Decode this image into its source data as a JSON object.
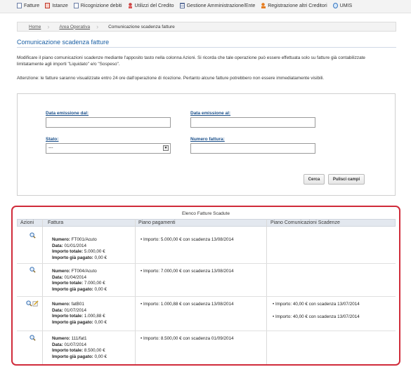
{
  "nav": [
    {
      "label": "Fatture",
      "icon": "document-icon"
    },
    {
      "label": "Istanze",
      "icon": "document-red-icon"
    },
    {
      "label": "Ricognizione debiti",
      "icon": "document-icon"
    },
    {
      "label": "Utilizzi del Credito",
      "icon": "figure-icon"
    },
    {
      "label": "Gestione Amministrazione/Ente",
      "icon": "grid-icon"
    },
    {
      "label": "Registrazione altri Creditori",
      "icon": "person-icon"
    },
    {
      "label": "UMIS",
      "icon": "globe-icon"
    }
  ],
  "breadcrumb": [
    "Home",
    "Area Operativa",
    "Comunicazione scadenza fatture"
  ],
  "page": {
    "title": "Comunicazione scadenza fatture",
    "description": "Modificare il piano comunicazioni scadenze mediante l'apposito tasto nella colonna Azioni. Si ricorda che tale operazione può essere effettuata solo su fatture già contabilizzate limitatamente agli importi \"Liquidato\" e/o \"Sospeso\".",
    "note": "Attenzione: le fatture saranno visualizzate entro 24 ore dall'operazione di ricezione. Pertanto alcune fatture potrebbero non essere immediatamente visibili."
  },
  "form": {
    "data_dal_label": "Data emissione dal:",
    "data_al_label": "Data emissione al:",
    "stato_label": "Stato:",
    "stato_value": "---",
    "numero_label": "Numero fattura:",
    "cerca_label": "Cerca",
    "pulisci_label": "Pulisci campi"
  },
  "results": {
    "caption": "Elenco Fatture Scadute",
    "headers": [
      "Azioni",
      "Fattura",
      "Piano pagamenti",
      "Piano Comunicazioni Scadenze"
    ],
    "rows": [
      {
        "numero_label": "Numero:",
        "numero": "FT001/Acuto",
        "data_label": "Data:",
        "data": "01/01/2014",
        "totale_label": "Importo totale:",
        "totale": "5.000,00 €",
        "pagato_label": "Importo già pagato:",
        "pagato": "0,00 €",
        "piano": "Importo: 5.000,00 € con scadenza 13/08/2014",
        "com": []
      },
      {
        "numero_label": "Numero:",
        "numero": "FT004/Acuto",
        "data_label": "Data:",
        "data": "01/04/2014",
        "totale_label": "Importo totale:",
        "totale": "7.000,00 €",
        "pagato_label": "Importo già pagato:",
        "pagato": "0,00 €",
        "piano": "Importo: 7.000,00 € con scadenza 13/08/2014",
        "com": []
      },
      {
        "numero_label": "Numero:",
        "numero": "fatB01",
        "data_label": "Data:",
        "data": "01/07/2014",
        "totale_label": "Importo totale:",
        "totale": "1.000,88 €",
        "pagato_label": "Importo già pagato:",
        "pagato": "0,00 €",
        "piano": "Importo: 1.000,88 € con scadenza 13/08/2014",
        "com": [
          "Importo: 40,00 € con scadenza 13/07/2014",
          "Importo: 40,00 € con scadenza 13/07/2014"
        ]
      },
      {
        "numero_label": "Numero:",
        "numero": "111/fat1",
        "data_label": "Data:",
        "data": "01/07/2014",
        "totale_label": "Importo totale:",
        "totale": "8.500,00 €",
        "pagato_label": "Importo già pagato:",
        "pagato": "0,00 €",
        "piano": "Importo: 8.500,00 € con scadenza 01/09/2014",
        "com": []
      }
    ]
  }
}
